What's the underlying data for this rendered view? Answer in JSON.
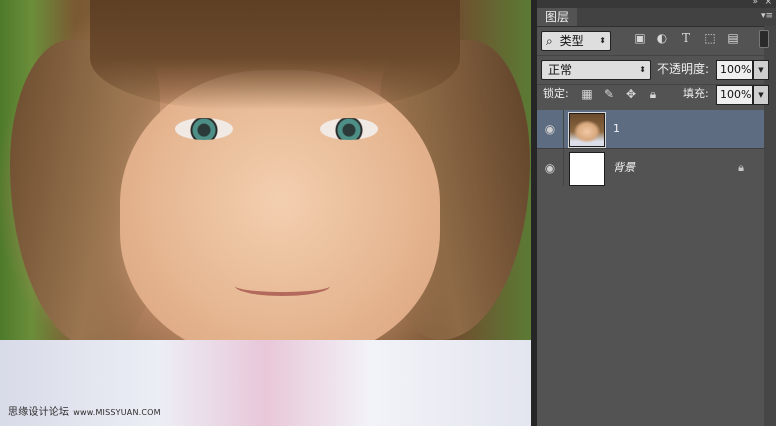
{
  "canvas": {
    "watermark_cn": "思缘设计论坛",
    "watermark_en": "www.MISSYUAN.COM"
  },
  "panel": {
    "tab_label": "图层",
    "menu_icon": "panel-menu-icon",
    "filter": {
      "selected": "类型",
      "icons": [
        "image-filter-icon",
        "adjustment-filter-icon",
        "type-filter-icon",
        "shape-filter-icon",
        "smart-object-filter-icon"
      ]
    },
    "blend_mode": "正常",
    "opacity_label": "不透明度:",
    "opacity_value": "100%",
    "lock_label": "锁定:",
    "lock_icons": [
      "lock-transparent-icon",
      "lock-image-icon",
      "lock-position-icon",
      "lock-all-icon"
    ],
    "fill_label": "填充:",
    "fill_value": "100%",
    "layers": [
      {
        "name": "1",
        "visible": true,
        "selected": true,
        "thumbnail": "photo"
      },
      {
        "name": "背景",
        "visible": true,
        "selected": false,
        "thumbnail": "white",
        "locked": true
      }
    ]
  },
  "colors": {
    "panel_bg": "#535353",
    "selected_layer": "#5d6c80",
    "dark_chrome": "#383838"
  }
}
